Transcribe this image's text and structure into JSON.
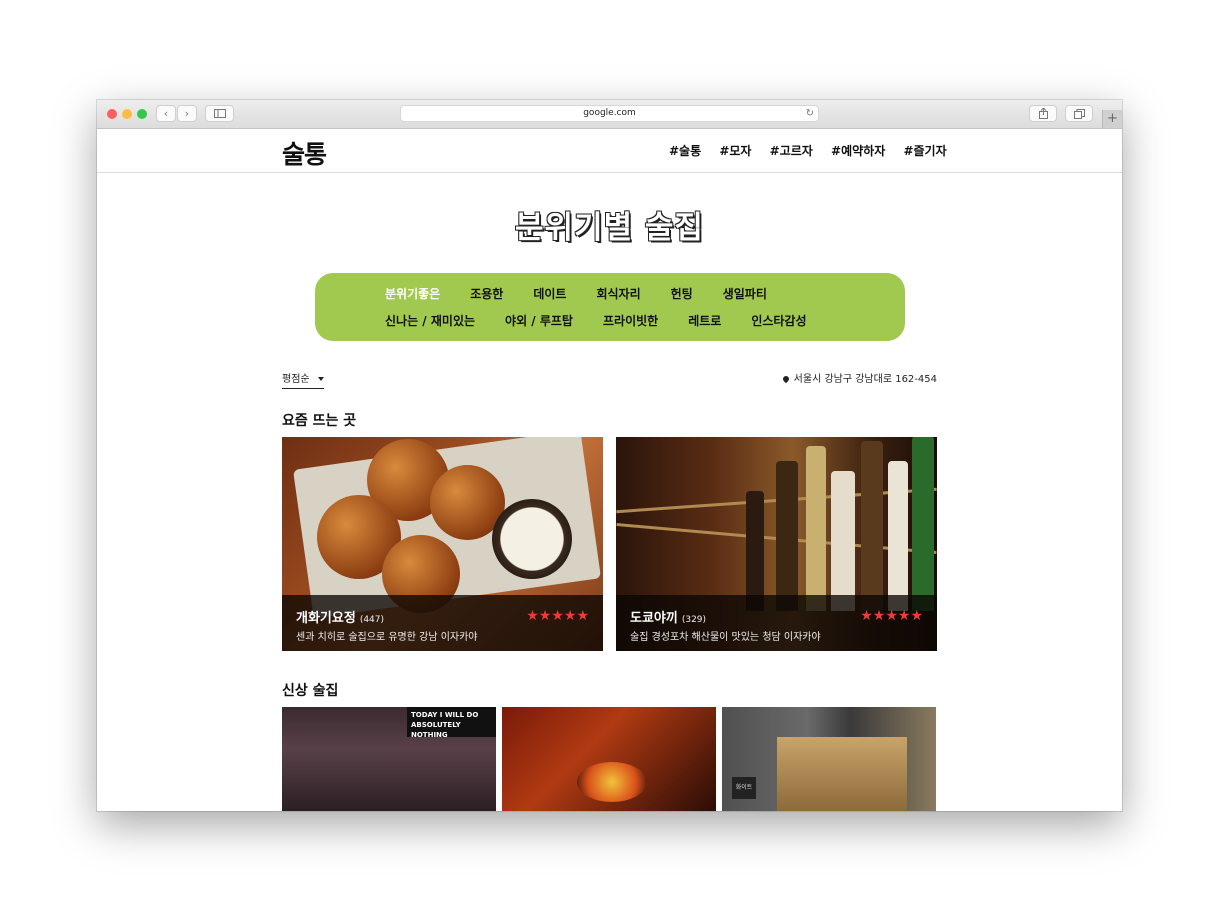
{
  "browser": {
    "url": "google.com",
    "reload_icon": "reload-icon",
    "share_icon": "share-icon",
    "tabs_icon": "tabs-icon",
    "new_tab_label": "+"
  },
  "site": {
    "logo": "술통",
    "nav": [
      "#술통",
      "#모자",
      "#고르자",
      "#예약하자",
      "#즐기자"
    ]
  },
  "page_title": "분위기별 술집",
  "categories": {
    "row1": [
      "분위기좋은",
      "조용한",
      "데이트",
      "회식자리",
      "헌팅",
      "생일파티"
    ],
    "row2": [
      "신나는 / 재미있는",
      "야외 / 루프탑",
      "프라이빗한",
      "레트로",
      "인스타감성"
    ]
  },
  "filters": {
    "sort_label": "평점순",
    "location": "서울시 강남구 강남대로 162-454"
  },
  "sections": {
    "trending_title": "요즘 뜨는 곳",
    "new_title": "신상 술집"
  },
  "trending": [
    {
      "name": "개화기요정",
      "count": "(447)",
      "desc": "센과 치히로 술집으로 유명한 강남 이자카야",
      "rating": 5,
      "stars": "★★★★★"
    },
    {
      "name": "도쿄야끼",
      "count": "(329)",
      "desc": "술집 경성포차 해산물이 맛있는 청담 이자카야",
      "rating": 5,
      "stars": "★★★★★"
    }
  ],
  "new_places": {
    "sign_text": "TODAY I WILL DO ABSOLUTELY NOTHING",
    "store_sign": "화이트"
  },
  "colors": {
    "accent_green": "#a1c94f",
    "star_red": "#ef3a3a"
  }
}
